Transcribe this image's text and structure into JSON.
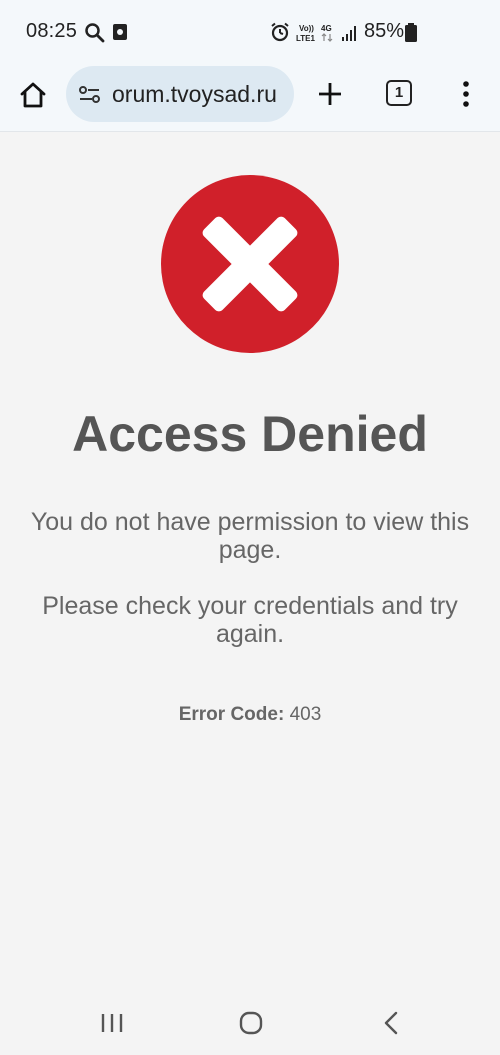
{
  "status_bar": {
    "time": "08:25",
    "battery": "85%",
    "icons": [
      "search-icon",
      "screen-record-icon",
      "alarm-icon",
      "volte-icon",
      "4g-icon",
      "signal-icon",
      "battery-icon"
    ]
  },
  "browser": {
    "url": "orum.tvoysad.ru",
    "tab_count": "1",
    "icons": [
      "home-icon",
      "tune-icon",
      "plus-icon",
      "tabs-icon",
      "more-vert-icon"
    ]
  },
  "page": {
    "title": "Access Denied",
    "message1": "You do not have permission to view this page.",
    "message2": "Please check your credentials and try again.",
    "error_label": "Error Code:",
    "error_value": "403",
    "colors": {
      "error_red": "#d0202a",
      "title_gray": "#555555"
    }
  },
  "nav_bar": {
    "icons": [
      "recents-icon",
      "home-circle-icon",
      "back-icon"
    ]
  }
}
